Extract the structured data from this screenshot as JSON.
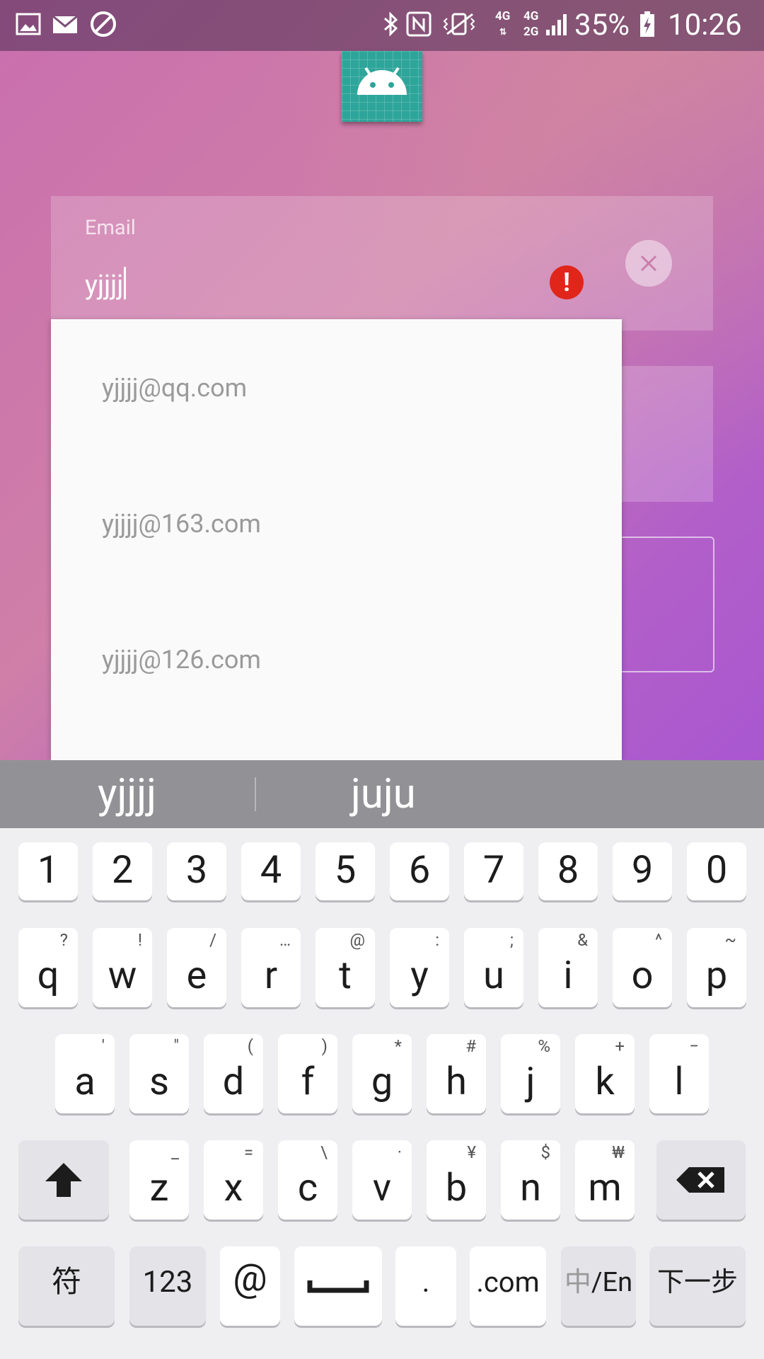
{
  "status_bar": {
    "network_top": "4G",
    "network_mid": "4G",
    "network_bottom": "2G",
    "battery": "35%",
    "time": "10:26"
  },
  "email_field": {
    "label": "Email",
    "value": "yjjjj"
  },
  "autocomplete": {
    "items": [
      "yjjjj@qq.com",
      "yjjjj@163.com",
      "yjjjj@126.com"
    ]
  },
  "keyboard": {
    "suggestions": [
      "yjjjj",
      "juju"
    ],
    "number_row": [
      "1",
      "2",
      "3",
      "4",
      "5",
      "6",
      "7",
      "8",
      "9",
      "0"
    ],
    "row1": [
      {
        "key": "q",
        "alt": "?"
      },
      {
        "key": "w",
        "alt": "!"
      },
      {
        "key": "e",
        "alt": "/"
      },
      {
        "key": "r",
        "alt": "…"
      },
      {
        "key": "t",
        "alt": "@"
      },
      {
        "key": "y",
        "alt": ":"
      },
      {
        "key": "u",
        "alt": ";"
      },
      {
        "key": "i",
        "alt": "&"
      },
      {
        "key": "o",
        "alt": "^"
      },
      {
        "key": "p",
        "alt": "~"
      }
    ],
    "row2": [
      {
        "key": "a",
        "alt": "'"
      },
      {
        "key": "s",
        "alt": "\""
      },
      {
        "key": "d",
        "alt": "("
      },
      {
        "key": "f",
        "alt": ")"
      },
      {
        "key": "g",
        "alt": "*"
      },
      {
        "key": "h",
        "alt": "#"
      },
      {
        "key": "j",
        "alt": "%"
      },
      {
        "key": "k",
        "alt": "+"
      },
      {
        "key": "l",
        "alt": "−"
      }
    ],
    "row3": [
      {
        "key": "z",
        "alt": "_"
      },
      {
        "key": "x",
        "alt": "="
      },
      {
        "key": "c",
        "alt": "\\"
      },
      {
        "key": "v",
        "alt": "·"
      },
      {
        "key": "b",
        "alt": "¥"
      },
      {
        "key": "n",
        "alt": "$"
      },
      {
        "key": "m",
        "alt": "₩"
      }
    ],
    "symbols_label": "符",
    "numbers_label": "123",
    "at_label": "@",
    "dot_label": ".",
    "dotcom_label": ".com",
    "lang_prefix": "中",
    "lang_label": "/En",
    "next_label": "下一步"
  },
  "colors": {
    "accent_error": "#e0261b",
    "logo_teal": "#2ea59a"
  }
}
